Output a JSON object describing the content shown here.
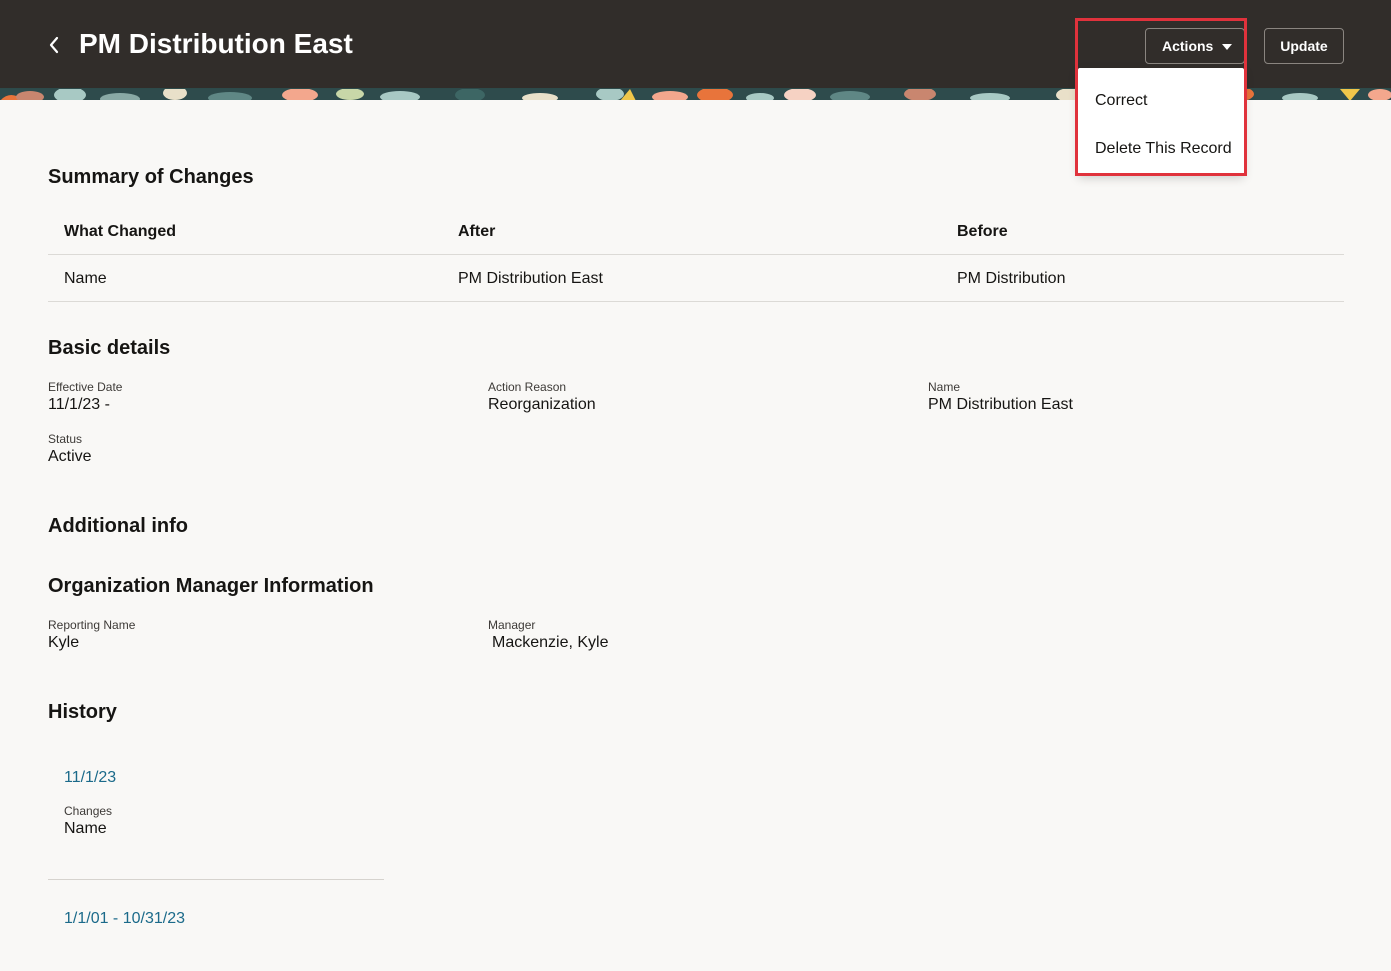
{
  "header": {
    "title": "PM Distribution East",
    "back_icon": "chevron-left-icon",
    "actions_label": "Actions",
    "update_label": "Update"
  },
  "actions_menu": {
    "items": [
      "Correct",
      "Delete This Record"
    ]
  },
  "colors": {
    "header_bg": "#312d2a",
    "link": "#1b6a8a",
    "highlight": "#e0323c",
    "page_bg": "#f9f8f6"
  },
  "summary": {
    "title": "Summary of Changes",
    "columns": [
      "What Changed",
      "After",
      "Before"
    ],
    "rows": [
      [
        "Name",
        "PM Distribution East",
        "PM Distribution"
      ]
    ]
  },
  "basic": {
    "title": "Basic details",
    "effective_date_label": "Effective Date",
    "effective_date": "11/1/23 -",
    "action_reason_label": "Action Reason",
    "action_reason": "Reorganization",
    "name_label": "Name",
    "name": "PM Distribution East",
    "status_label": "Status",
    "status": "Active"
  },
  "additional": {
    "title": "Additional info"
  },
  "manager_info": {
    "title": "Organization Manager Information",
    "reporting_name_label": "Reporting Name",
    "reporting_name": "Kyle",
    "manager_label": "Manager",
    "manager": "Mackenzie, Kyle"
  },
  "history": {
    "title": "History",
    "entries": [
      {
        "date": "11/1/23",
        "changes_label": "Changes",
        "changes": "Name"
      },
      {
        "date": "1/1/01 - 10/31/23"
      }
    ]
  }
}
